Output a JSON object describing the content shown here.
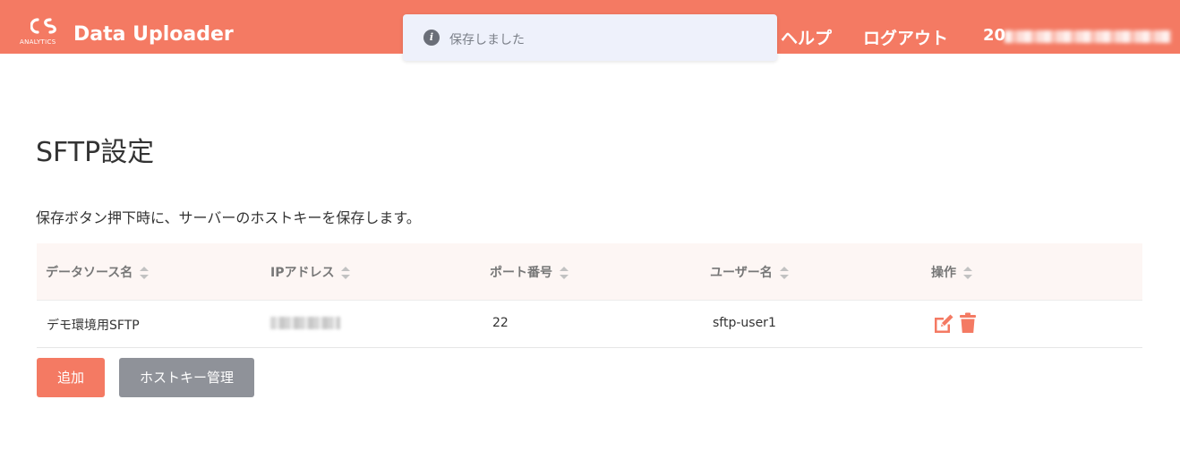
{
  "header": {
    "logo_text": "ANALYTICS",
    "app_title": "Data Uploader",
    "nav_help": "ヘルプ",
    "nav_logout": "ログアウト",
    "user_prefix": "20"
  },
  "toast": {
    "message": "保存しました",
    "icon": "info-icon"
  },
  "page": {
    "title": "SFTP設定",
    "description": "保存ボタン押下時に、サーバーのホストキーを保存します。"
  },
  "table": {
    "columns": [
      "データソース名",
      "IPアドレス",
      "ポート番号",
      "ユーザー名",
      "操作"
    ],
    "rows": [
      {
        "datasource": "デモ環境用SFTP",
        "ip": "",
        "port": "22",
        "user": "sftp-user1",
        "actions": [
          "edit-icon",
          "trash-icon"
        ]
      }
    ]
  },
  "buttons": {
    "add": "追加",
    "hostkey": "ホストキー管理"
  },
  "colors": {
    "accent": "#f47a63",
    "secondary_button": "#8f9299",
    "table_header_bg": "#fdf6f4",
    "toast_bg": "#eef1fb"
  }
}
